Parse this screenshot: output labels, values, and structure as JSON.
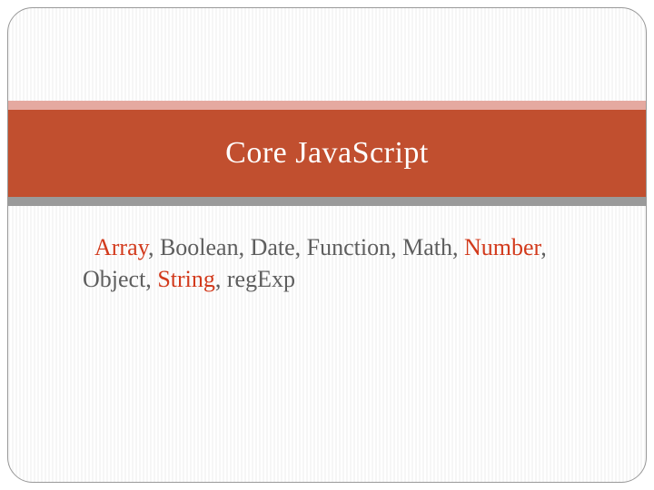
{
  "title": "Core JavaScript",
  "types": {
    "t1": "Array",
    "s1": ", Boolean, Date, Function, Math, ",
    "t2": "Number",
    "s2": ", Object, ",
    "t3": "String",
    "s3": ", regExp"
  }
}
